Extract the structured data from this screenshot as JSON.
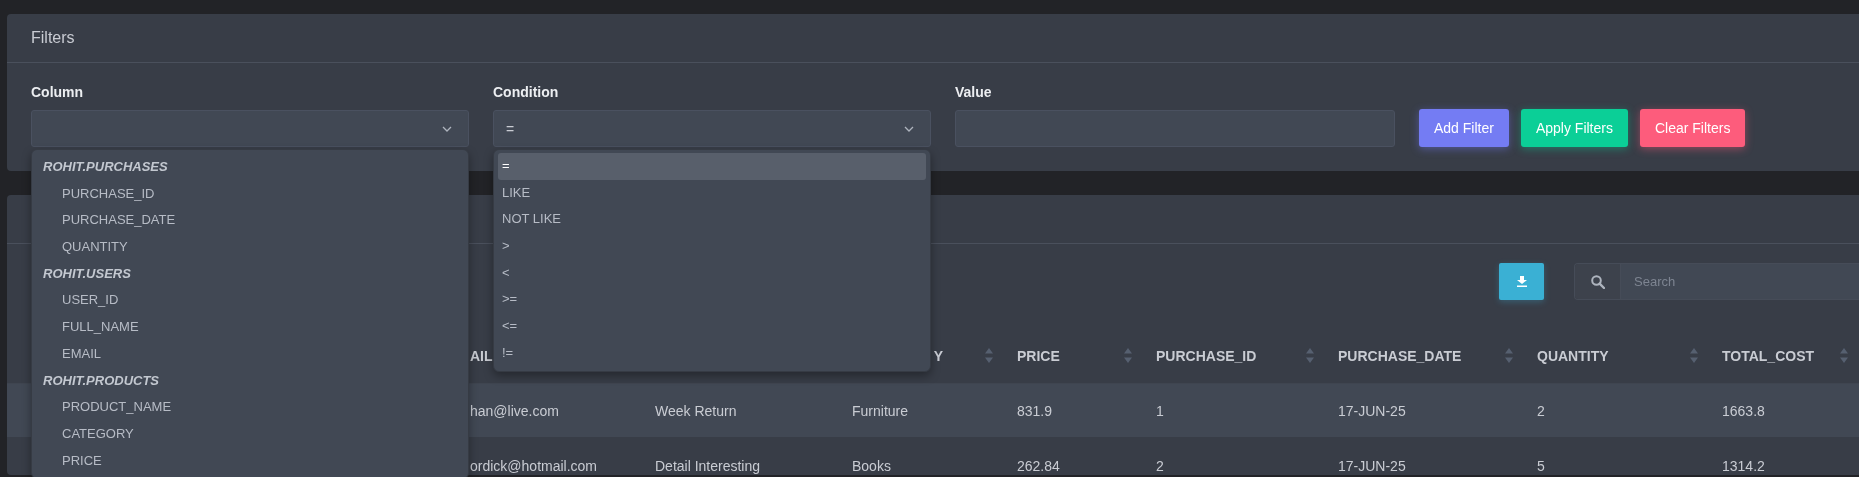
{
  "filters": {
    "title": "Filters",
    "column": {
      "label": "Column",
      "expanded": true,
      "groups": [
        {
          "name": "ROHIT.PURCHASES",
          "options": [
            {
              "label": "PURCHASE_ID",
              "selected": false
            },
            {
              "label": "PURCHASE_DATE",
              "selected": false
            },
            {
              "label": "QUANTITY",
              "selected": false
            }
          ]
        },
        {
          "name": "ROHIT.USERS",
          "options": [
            {
              "label": "USER_ID",
              "selected": false
            },
            {
              "label": "FULL_NAME",
              "selected": false
            },
            {
              "label": "EMAIL",
              "selected": false
            }
          ]
        },
        {
          "name": "ROHIT.PRODUCTS",
          "options": [
            {
              "label": "PRODUCT_NAME",
              "selected": false
            },
            {
              "label": "CATEGORY",
              "selected": false
            },
            {
              "label": "PRICE",
              "selected": false
            }
          ]
        }
      ]
    },
    "condition": {
      "label": "Condition",
      "value": "=",
      "expanded": true,
      "options": [
        {
          "label": "=",
          "selected": true
        },
        {
          "label": "LIKE",
          "selected": false
        },
        {
          "label": "NOT LIKE",
          "selected": false
        },
        {
          "label": ">",
          "selected": false
        },
        {
          "label": "<",
          "selected": false
        },
        {
          "label": ">=",
          "selected": false
        },
        {
          "label": "<=",
          "selected": false
        },
        {
          "label": "!=",
          "selected": false
        }
      ]
    },
    "value": {
      "label": "Value"
    },
    "buttons": [
      {
        "label": "Add Filter",
        "kind": "add"
      },
      {
        "label": "Apply Filters",
        "kind": "apply"
      },
      {
        "label": "Clear Filters",
        "kind": "clear"
      }
    ]
  },
  "results": {
    "search": {
      "placeholder": "Search"
    },
    "table": {
      "columns": [
        {
          "label": "AIL"
        },
        {},
        {
          "label": "Y",
          "sortable": true,
          "clipped": true
        },
        {
          "label": "PRICE",
          "sortable": true,
          "clipped": false
        },
        {
          "label": "PURCHASE_ID",
          "sortable": true,
          "clipped": false
        },
        {
          "label": "PURCHASE_DATE",
          "sortable": true,
          "clipped": false
        },
        {
          "label": "QUANTITY",
          "sortable": true,
          "clipped": false
        },
        {
          "label": "TOTAL_COST",
          "sortable": true,
          "clipped": false
        }
      ],
      "rows": [
        [
          "han@live.com",
          "Week Return",
          "Furniture",
          "831.9",
          "1",
          "17-JUN-25",
          "2",
          "1663.8"
        ],
        [
          "ordick@hotmail.com",
          "Detail Interesting",
          "Books",
          "262.84",
          "2",
          "17-JUN-25",
          "5",
          "1314.2"
        ]
      ]
    }
  }
}
